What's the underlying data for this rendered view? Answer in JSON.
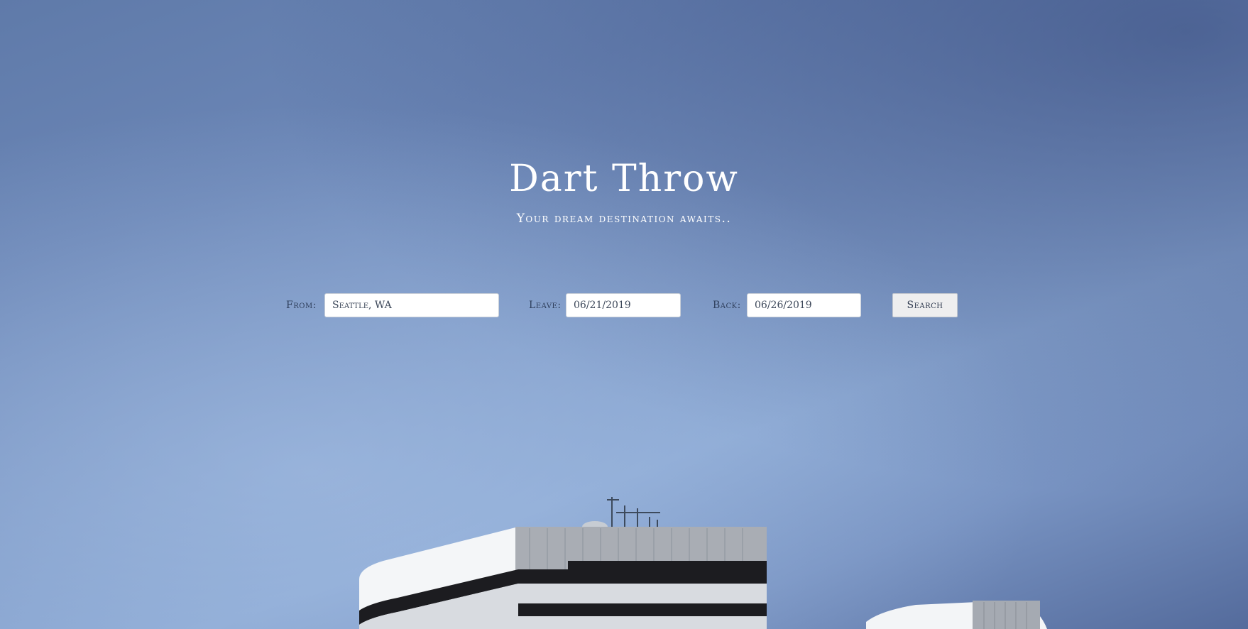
{
  "hero": {
    "title": "Dart Throw",
    "subtitle": "Your dream destination awaits.."
  },
  "form": {
    "from_label": "From:",
    "from_value": "Seattle, WA",
    "leave_label": "Leave:",
    "leave_value": "06/21/2019",
    "back_label": "Back:",
    "back_value": "06/26/2019",
    "search_label": "Search"
  },
  "colors": {
    "sky_top": "#5f7aa9",
    "sky_mid": "#8aa7d2",
    "text_light": "#ffffff",
    "label_dark": "#2f3f5c",
    "button_bg": "#eeeeef"
  }
}
